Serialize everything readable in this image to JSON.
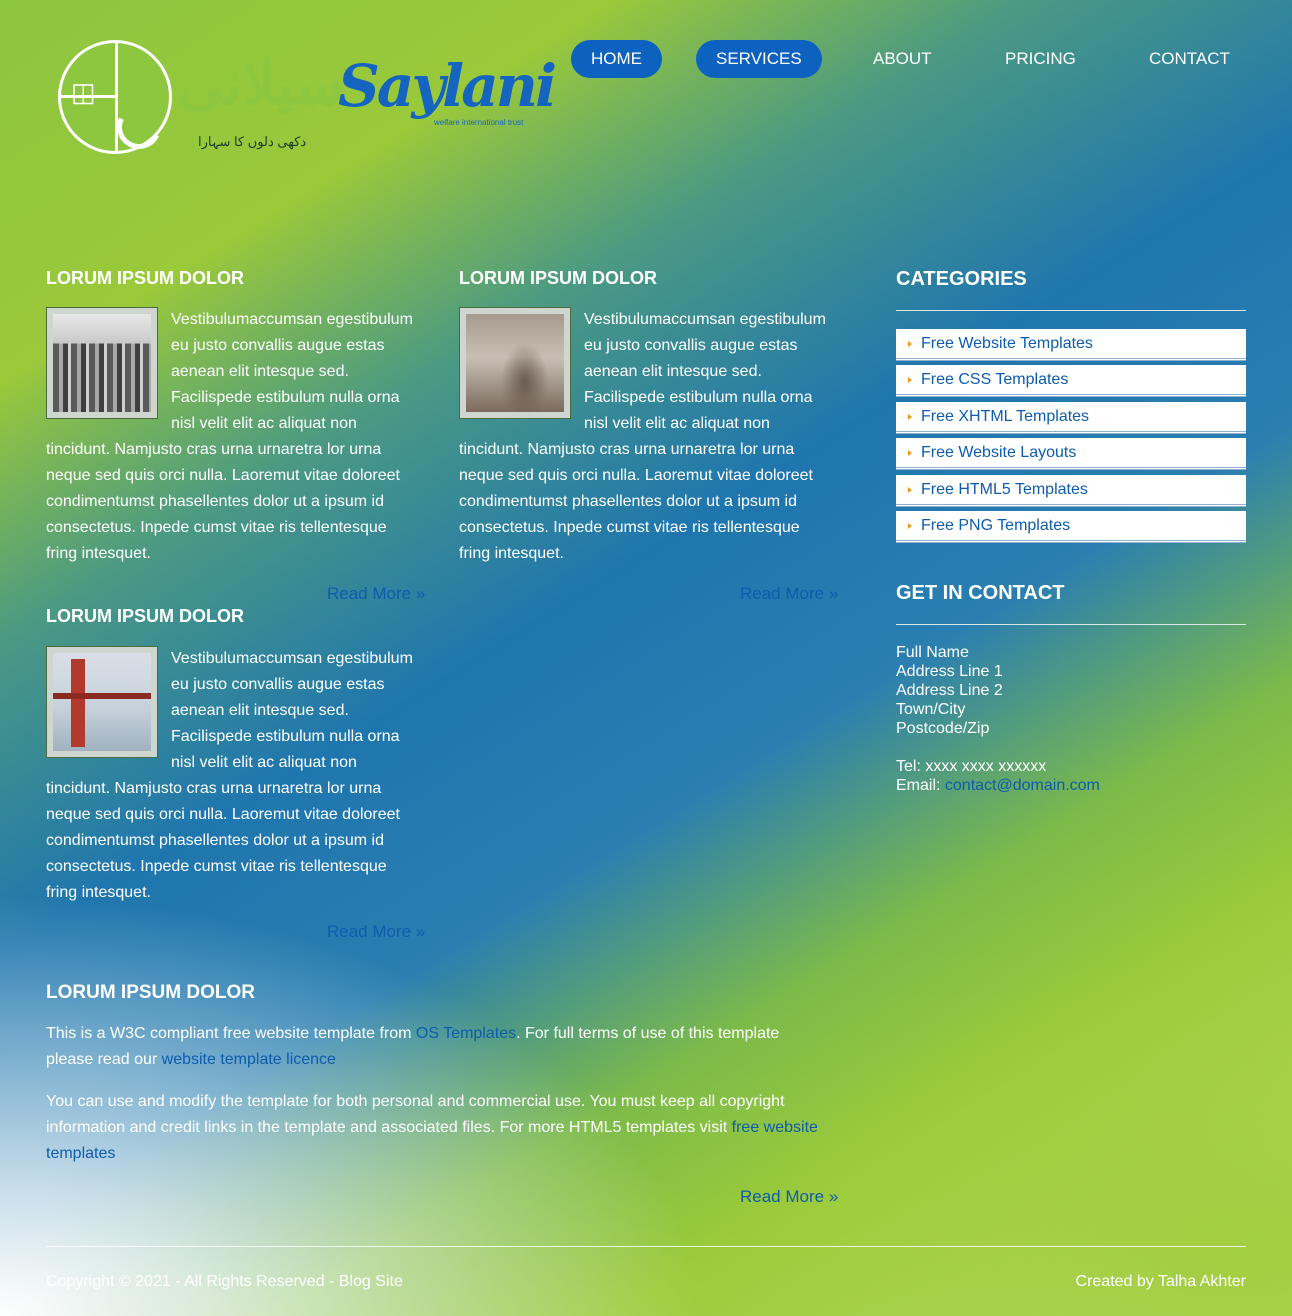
{
  "logo": {
    "urdu_text": "سیلانی",
    "latin_text": "Saylani",
    "tagline": "welfare international trust",
    "subtitle": "دکھی دلوں کا سہارا"
  },
  "nav": {
    "items": [
      {
        "label": "HOME"
      },
      {
        "label": "SERVICES"
      },
      {
        "label": "ABOUT"
      },
      {
        "label": "PRICING"
      },
      {
        "label": "CONTACT"
      }
    ],
    "active_color": "#0d62bf"
  },
  "articles": [
    {
      "title": "LORUM IPSUM DOLOR",
      "lines": [
        "Vestibulumaccumsan egestibulum",
        "eu justo convallis augue estas",
        "aenean elit intesque sed.",
        "Facilispede estibulum nulla orna",
        "nisl velit elit ac aliquat non",
        "tincidunt. Namjusto cras urna urnaretra lor urna",
        "neque sed quis orci nulla. Laoremut vitae doloreet",
        "condimentumst phasellentes dolor ut a ipsum id",
        "consectetus. Inpede cumst vitae ris tellentesque",
        "fring intesquet."
      ],
      "read_more": "Read More »",
      "image_icon": "city-photo"
    },
    {
      "title": "LORUM IPSUM DOLOR",
      "lines": [
        "Vestibulumaccumsan egestibulum",
        "eu justo convallis augue estas",
        "aenean elit intesque sed.",
        "Facilispede estibulum nulla orna",
        "nisl velit elit ac aliquat non",
        "tincidunt. Namjusto cras urna urnaretra lor urna",
        "neque sed quis orci nulla. Laoremut vitae doloreet",
        "condimentumst phasellentes dolor ut a ipsum id",
        "consectetus. Inpede cumst vitae ris tellentesque",
        "fring intesquet."
      ],
      "read_more": "Read More »",
      "image_icon": "paris-photo"
    },
    {
      "title": "LORUM IPSUM DOLOR",
      "lines": [
        "Vestibulumaccumsan egestibulum",
        "eu justo convallis augue estas",
        "aenean elit intesque sed.",
        "Facilispede estibulum nulla orna",
        "nisl velit elit ac aliquat non",
        "tincidunt. Namjusto cras urna urnaretra lor urna",
        "neque sed quis orci nulla. Laoremut vitae doloreet",
        "condimentumst phasellentes dolor ut a ipsum id",
        "consectetus. Inpede cumst vitae ris tellentesque",
        "fring intesquet."
      ],
      "read_more": "Read More »",
      "image_icon": "bridge-photo"
    }
  ],
  "intro": {
    "title": "LORUM IPSUM DOLOR",
    "p1_text1": "This is a W3C compliant free website template from ",
    "p1_link1": "OS Templates",
    "p1_text2": ". For full terms of use of this template",
    "p1_text3": "please read our ",
    "p1_link2": "website template licence",
    "p2_text1": "You can use and modify the template for both personal and commercial use. You must keep all copyright",
    "p2_text2": "information and credit links in the template and associated files. For more HTML5 templates visit ",
    "p2_link1": "free website",
    "p2_link2": "templates",
    "read_more": "Read More »"
  },
  "sidebar": {
    "categories_title": "CATEGORIES",
    "categories": [
      "Free Website Templates",
      "Free CSS Templates",
      "Free XHTML Templates",
      "Free Website Layouts",
      "Free HTML5 Templates",
      "Free PNG Templates"
    ],
    "bullet_color": "#f29a1d",
    "contact_title": "GET IN CONTACT",
    "contact_lines": [
      "Full Name",
      "Address Line 1",
      "Address Line 2",
      "Town/City",
      "Postcode/Zip"
    ],
    "tel": "Tel: xxxx xxxx xxxxxx",
    "email_label": "Email: ",
    "email": "contact@domain.com"
  },
  "footer": {
    "left": "Copyright © 2021 - All Rights Reserved - Blog Site",
    "right": "Created by Talha Akhter"
  },
  "colors": {
    "link": "#0d5cad",
    "accent_green": "#8dc63f",
    "accent_blue": "#1565c0"
  }
}
